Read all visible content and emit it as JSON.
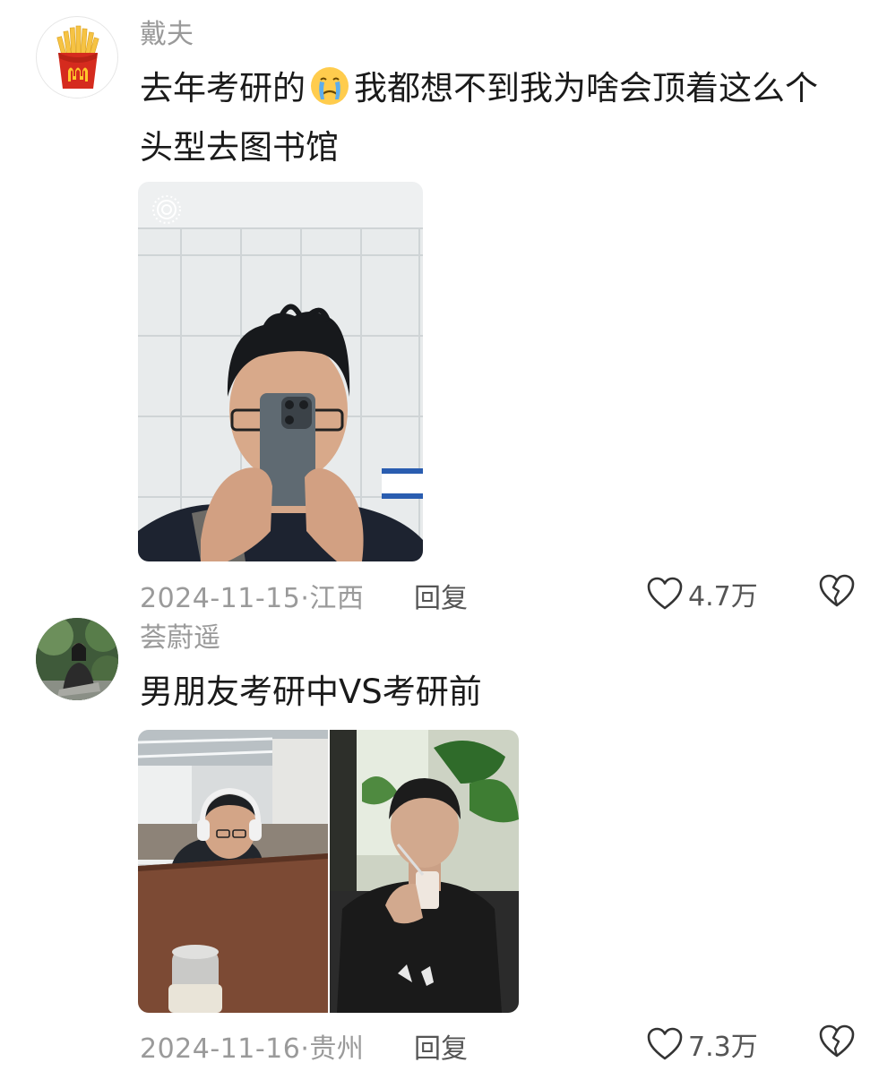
{
  "comments": [
    {
      "username": "戴夫",
      "text_before_emoji": "去年考研的",
      "emoji": "crying-face-emoji",
      "text_line1_after_emoji": "我都想不到我为啥会顶着这么个",
      "text_line2": "头型去图书馆",
      "date": "2024-11-15",
      "location": "江西",
      "reply_label": "回复",
      "likes": "4.7万",
      "avatar": "mcdonalds-fries-icon",
      "photo": "mirror-selfie-photo"
    },
    {
      "username": "荟蔚遥",
      "text": "男朋友考研中VS考研前",
      "date": "2024-11-16",
      "location": "贵州",
      "reply_label": "回复",
      "likes": "7.3万",
      "avatar": "user-photo-avatar",
      "photo": "before-after-photo"
    }
  ],
  "colors": {
    "text": "#1a1a1a",
    "meta": "#9a9a9a",
    "accent_red": "#d52b1e",
    "accent_yellow": "#ffc72c"
  }
}
